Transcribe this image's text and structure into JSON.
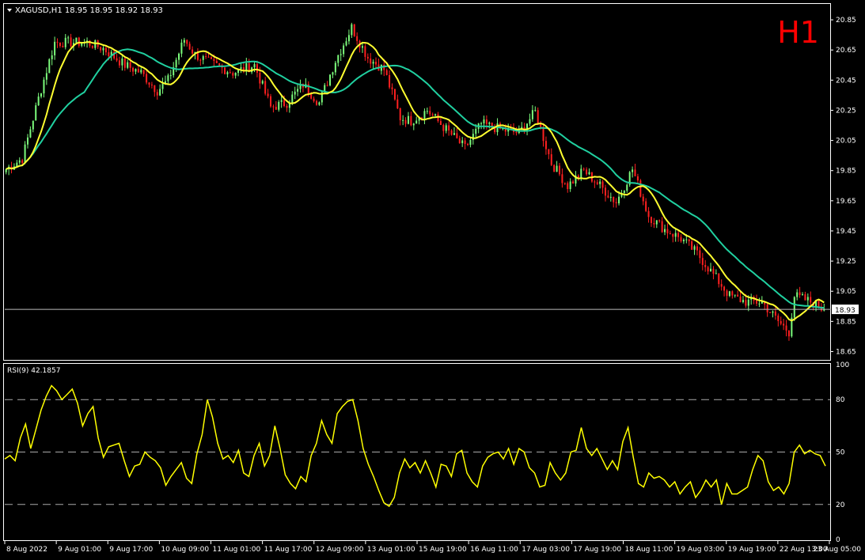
{
  "header": {
    "symbol_line": "XAGUSD,H1  18.95 18.95 18.92 18.93",
    "timeframe_badge": "H1",
    "rsi_label": "RSI(9) 42.1857"
  },
  "colors": {
    "background": "#000000",
    "bull_candle": "#7CFC7C",
    "bear_candle": "#FF2020",
    "fast_ma": "#FFFF30",
    "slow_ma": "#20D0A0",
    "rsi_line": "#FFFF00",
    "grid_text": "#FFFFFF",
    "badge": "#FF0000"
  },
  "chart_data": [
    {
      "type": "candlestick",
      "title": "XAGUSD,H1",
      "ylim": [
        18.6,
        20.95
      ],
      "y_ticks": [
        "20.85",
        "20.65",
        "20.45",
        "20.25",
        "20.05",
        "19.85",
        "19.65",
        "19.45",
        "19.25",
        "19.05",
        "18.85",
        "18.65"
      ],
      "current_price": "18.93",
      "ohlc_anchor_closes": [
        {
          "i": 0,
          "c": 19.86
        },
        {
          "i": 6,
          "c": 19.93
        },
        {
          "i": 12,
          "c": 20.33
        },
        {
          "i": 18,
          "c": 20.7
        },
        {
          "i": 24,
          "c": 20.7
        },
        {
          "i": 30,
          "c": 20.7
        },
        {
          "i": 36,
          "c": 20.66
        },
        {
          "i": 44,
          "c": 20.55
        },
        {
          "i": 50,
          "c": 20.5
        },
        {
          "i": 56,
          "c": 20.38
        },
        {
          "i": 60,
          "c": 20.45
        },
        {
          "i": 66,
          "c": 20.72
        },
        {
          "i": 70,
          "c": 20.62
        },
        {
          "i": 76,
          "c": 20.56
        },
        {
          "i": 84,
          "c": 20.5
        },
        {
          "i": 92,
          "c": 20.55
        },
        {
          "i": 98,
          "c": 20.27
        },
        {
          "i": 104,
          "c": 20.3
        },
        {
          "i": 110,
          "c": 20.42
        },
        {
          "i": 116,
          "c": 20.3
        },
        {
          "i": 122,
          "c": 20.58
        },
        {
          "i": 128,
          "c": 20.8
        },
        {
          "i": 134,
          "c": 20.6
        },
        {
          "i": 140,
          "c": 20.52
        },
        {
          "i": 146,
          "c": 20.2
        },
        {
          "i": 150,
          "c": 20.18
        },
        {
          "i": 156,
          "c": 20.25
        },
        {
          "i": 162,
          "c": 20.14
        },
        {
          "i": 170,
          "c": 20.0
        },
        {
          "i": 176,
          "c": 20.16
        },
        {
          "i": 184,
          "c": 20.12
        },
        {
          "i": 190,
          "c": 20.1
        },
        {
          "i": 196,
          "c": 20.24
        },
        {
          "i": 202,
          "c": 19.9
        },
        {
          "i": 208,
          "c": 19.75
        },
        {
          "i": 214,
          "c": 19.85
        },
        {
          "i": 220,
          "c": 19.75
        },
        {
          "i": 226,
          "c": 19.64
        },
        {
          "i": 232,
          "c": 19.86
        },
        {
          "i": 238,
          "c": 19.55
        },
        {
          "i": 244,
          "c": 19.46
        },
        {
          "i": 250,
          "c": 19.4
        },
        {
          "i": 256,
          "c": 19.3
        },
        {
          "i": 262,
          "c": 19.16
        },
        {
          "i": 268,
          "c": 19.02
        },
        {
          "i": 274,
          "c": 18.98
        },
        {
          "i": 280,
          "c": 18.98
        },
        {
          "i": 286,
          "c": 18.85
        },
        {
          "i": 290,
          "c": 18.78
        },
        {
          "i": 292,
          "c": 19.02
        },
        {
          "i": 298,
          "c": 18.98
        },
        {
          "i": 303,
          "c": 18.93
        }
      ],
      "series": [
        {
          "name": "fast MA",
          "color": "#FFFF30"
        },
        {
          "name": "slow MA",
          "color": "#20D0A0"
        }
      ]
    },
    {
      "type": "line",
      "title": "RSI(9) 42.1857",
      "ylim": [
        0,
        100
      ],
      "y_ticks": [
        "100",
        "80",
        "50",
        "20",
        "0"
      ],
      "levels": [
        80,
        50,
        20
      ],
      "series": [
        {
          "name": "RSI(9)",
          "values": [
            46,
            48,
            45,
            58,
            66,
            52,
            63,
            74,
            82,
            88,
            85,
            80,
            83,
            86,
            78,
            65,
            72,
            76,
            58,
            47,
            53,
            54,
            55,
            45,
            36,
            42,
            43,
            50,
            47,
            45,
            41,
            31,
            36,
            40,
            44,
            35,
            32,
            49,
            60,
            80,
            70,
            55,
            46,
            48,
            44,
            51,
            38,
            36,
            48,
            55,
            42,
            48,
            65,
            52,
            37,
            32,
            29,
            36,
            33,
            48,
            55,
            68,
            60,
            55,
            72,
            76,
            79,
            80,
            68,
            52,
            43,
            36,
            28,
            21,
            19,
            24,
            38,
            46,
            41,
            44,
            38,
            45,
            38,
            30,
            43,
            42,
            36,
            49,
            51,
            38,
            33,
            30,
            42,
            47,
            49,
            50,
            46,
            52,
            43,
            52,
            50,
            41,
            38,
            30,
            31,
            44,
            38,
            34,
            38,
            50,
            51,
            64,
            52,
            48,
            52,
            46,
            40,
            45,
            40,
            56,
            64,
            47,
            32,
            30,
            38,
            35,
            36,
            34,
            30,
            33,
            26,
            30,
            33,
            24,
            28,
            34,
            30,
            34,
            20,
            32,
            26,
            26,
            28,
            30,
            40,
            48,
            45,
            33,
            28,
            30,
            26,
            32,
            50,
            54,
            49,
            51,
            49,
            48,
            42
          ]
        }
      ]
    }
  ],
  "x_axis": {
    "labels": [
      "8 Aug 2022",
      "9 Aug 01:00",
      "9 Aug 17:00",
      "10 Aug 09:00",
      "11 Aug 01:00",
      "11 Aug 17:00",
      "12 Aug 09:00",
      "13 Aug 01:00",
      "15 Aug 19:00",
      "16 Aug 11:00",
      "17 Aug 03:00",
      "17 Aug 19:00",
      "18 Aug 11:00",
      "19 Aug 03:00",
      "19 Aug 19:00",
      "22 Aug 13:00",
      "23 Aug 05:00"
    ]
  }
}
